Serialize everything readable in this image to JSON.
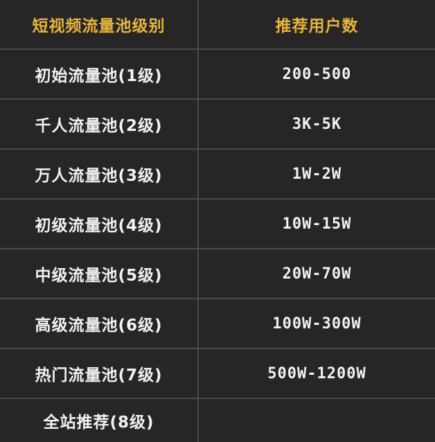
{
  "table": {
    "header": {
      "level": "短视频流量池级别",
      "users": "推荐用户数"
    },
    "rows": [
      {
        "level": "初始流量池(1级)",
        "users": "200-500"
      },
      {
        "level": "千人流量池(2级)",
        "users": "3K-5K"
      },
      {
        "level": "万人流量池(3级)",
        "users": "1W-2W"
      },
      {
        "level": "初级流量池(4级)",
        "users": "10W-15W"
      },
      {
        "level": "中级流量池(5级)",
        "users": "20W-70W"
      },
      {
        "level": "高级流量池(6级)",
        "users": "100W-300W"
      },
      {
        "level": "热门流量池(7级)",
        "users": "500W-1200W"
      },
      {
        "level": "全站推荐(8级)",
        "users": ""
      }
    ],
    "colors": {
      "background": "#262626",
      "border": "#4a4a4a",
      "header_text": "#e7b43c",
      "body_text": "#f2f2f2"
    }
  }
}
